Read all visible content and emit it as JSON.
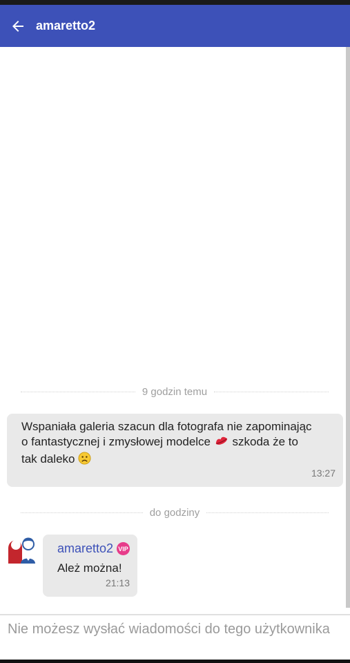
{
  "header": {
    "title": "amaretto2",
    "back_icon": "arrow-left-icon"
  },
  "dividers": [
    {
      "label": "9 godzin temu"
    },
    {
      "label": "do godziny"
    }
  ],
  "messages": [
    {
      "text_line1": "Wspaniała galeria szacun dla fotografa nie zapominając",
      "text_line2": "o fantastycznej i zmysłowej modelce",
      "text_line3a": "szkoda że to",
      "text_line3b": "tak daleko",
      "time": "13:27"
    },
    {
      "username": "amaretto2",
      "badge": "VIP",
      "text": "Ależ można!",
      "time": "21:13"
    }
  ],
  "composer": {
    "notice": "Nie możesz wysłać wiadomości do tego użytkownika"
  },
  "colors": {
    "appbar": "#3d51b8",
    "bubble": "#e9e9e9",
    "vip": "#e73c8a"
  }
}
